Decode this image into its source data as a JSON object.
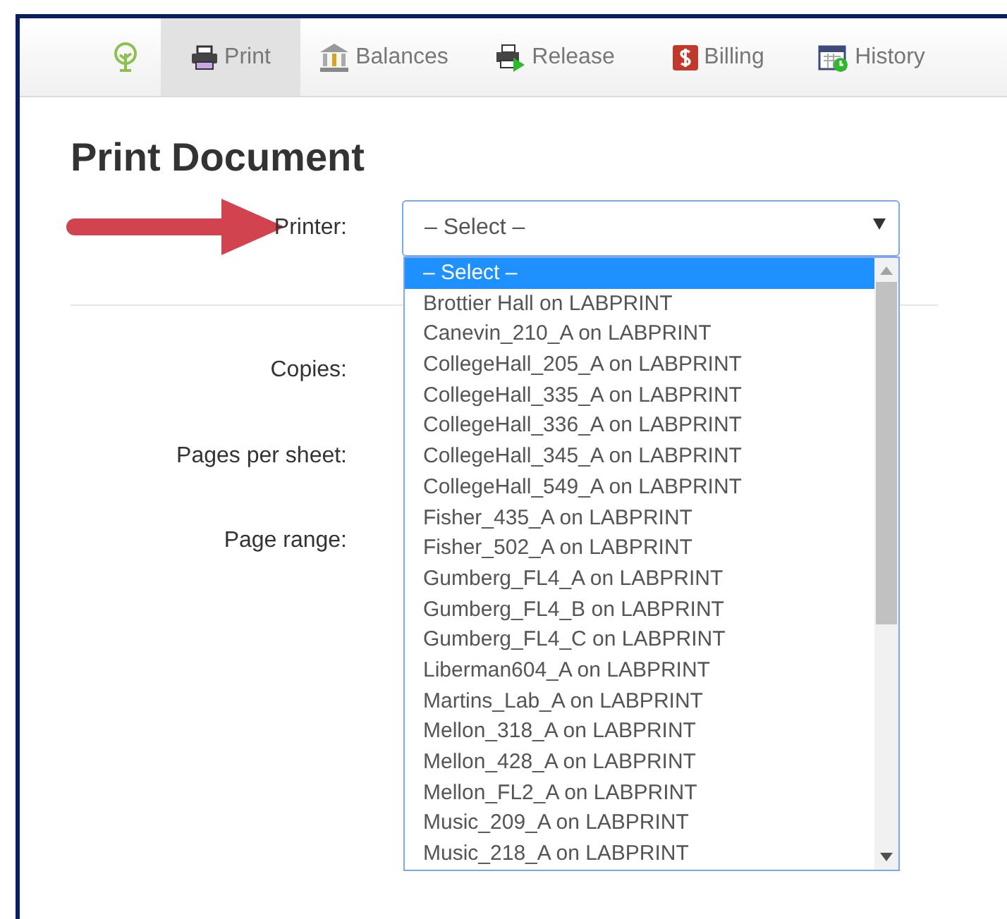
{
  "nav": {
    "tabs": [
      {
        "kind": "home",
        "selected": false
      },
      {
        "kind": "print",
        "label": "Print",
        "selected": true
      },
      {
        "kind": "balances",
        "label": "Balances",
        "selected": false
      },
      {
        "kind": "release",
        "label": "Release",
        "selected": false
      },
      {
        "kind": "billing",
        "label": "Billing",
        "selected": false
      },
      {
        "kind": "history",
        "label": "History",
        "selected": false
      }
    ]
  },
  "page_title": "Print Document",
  "form": {
    "printer_label": "Printer:",
    "printer_select": {
      "value": "– Select –",
      "expanded": true,
      "options": [
        {
          "label": "– Select –",
          "selected": true
        },
        {
          "label": "Brottier Hall on LABPRINT",
          "selected": false
        },
        {
          "label": "Canevin_210_A on LABPRINT",
          "selected": false
        },
        {
          "label": "CollegeHall_205_A on LABPRINT",
          "selected": false
        },
        {
          "label": "CollegeHall_335_A on LABPRINT",
          "selected": false
        },
        {
          "label": "CollegeHall_336_A on LABPRINT",
          "selected": false
        },
        {
          "label": "CollegeHall_345_A on LABPRINT",
          "selected": false
        },
        {
          "label": "CollegeHall_549_A on LABPRINT",
          "selected": false
        },
        {
          "label": "Fisher_435_A on LABPRINT",
          "selected": false
        },
        {
          "label": "Fisher_502_A on LABPRINT",
          "selected": false
        },
        {
          "label": "Gumberg_FL4_A on LABPRINT",
          "selected": false
        },
        {
          "label": "Gumberg_FL4_B on LABPRINT",
          "selected": false
        },
        {
          "label": "Gumberg_FL4_C on LABPRINT",
          "selected": false
        },
        {
          "label": "Liberman604_A on LABPRINT",
          "selected": false
        },
        {
          "label": "Martins_Lab_A on LABPRINT",
          "selected": false
        },
        {
          "label": "Mellon_318_A on LABPRINT",
          "selected": false
        },
        {
          "label": "Mellon_428_A on LABPRINT",
          "selected": false
        },
        {
          "label": "Mellon_FL2_A on LABPRINT",
          "selected": false
        },
        {
          "label": "Music_209_A on LABPRINT",
          "selected": false
        },
        {
          "label": "Music_218_A on LABPRINT",
          "selected": false
        }
      ]
    },
    "field_labels": [
      "Copies:",
      "Pages per sheet:",
      "Page range:"
    ]
  }
}
